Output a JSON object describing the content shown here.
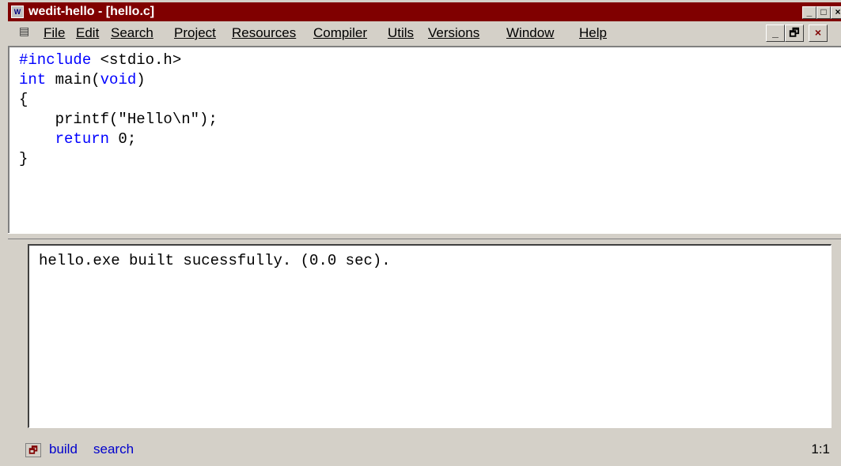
{
  "window": {
    "app_icon": "app-icon",
    "title": "wedit-hello - [hello.c]",
    "controls": {
      "minimize": "_",
      "maximize": "□",
      "close": "×"
    },
    "title_color": "#800000"
  },
  "menu": {
    "items": [
      {
        "label": "File"
      },
      {
        "label": "Edit"
      },
      {
        "label": "Search"
      },
      {
        "label": "Project"
      },
      {
        "label": "Resources"
      },
      {
        "label": "Compiler"
      },
      {
        "label": "Utils"
      },
      {
        "label": "Versions"
      },
      {
        "label": "Window"
      },
      {
        "label": "Help"
      }
    ],
    "mdi_controls": {
      "minimize": "_",
      "restore": "🗗",
      "close": "×"
    }
  },
  "editor": {
    "lines": [
      "#include <stdio.h>",
      "int main(void)",
      "{",
      "    printf(\"Hello\\n\");",
      "    return 0;",
      "}"
    ],
    "keyword_color": "#0000ff"
  },
  "output": {
    "text": "hello.exe built sucessfully. (0.0 sec)."
  },
  "status": {
    "tabs": [
      "build",
      "search"
    ],
    "position": "1:1"
  }
}
